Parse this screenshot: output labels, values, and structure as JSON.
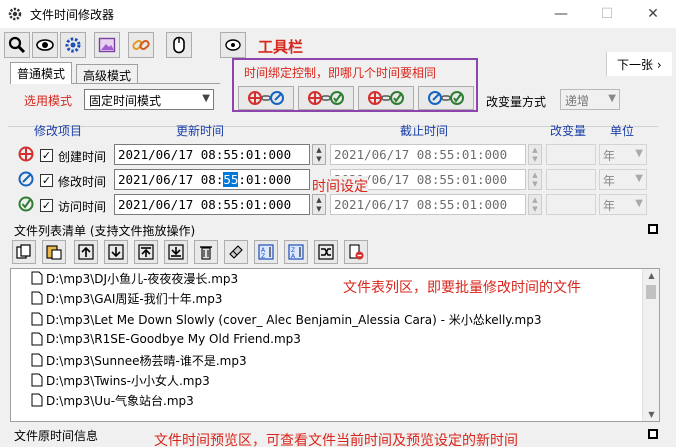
{
  "window": {
    "title": "文件时间修改器",
    "minimize": "—",
    "maximize": "☐",
    "close": "✕"
  },
  "toolbar": {
    "annotation": "工具栏",
    "buttons": [
      "search-icon",
      "eye-icon",
      "settings-gear-icon",
      "image-icon",
      "link-icon",
      "mouse-icon",
      "eye-help-icon"
    ]
  },
  "tabs": [
    {
      "label": "普通模式",
      "active": true
    },
    {
      "label": "高级模式",
      "active": false
    }
  ],
  "link_group": {
    "annotation": "时间绑定控制，即哪几个时间要相同",
    "buttons": [
      "link-create-modify-icon",
      "link-create-access-icon",
      "link-modify-access-icon",
      "link-all-icon"
    ]
  },
  "next": {
    "label": "下一张 ›"
  },
  "mode": {
    "label": "选用模式",
    "value": "固定时间模式"
  },
  "change_mode": {
    "label": "改变量方式",
    "value": "递增"
  },
  "headers": {
    "item": "修改项目",
    "update_time": "更新时间",
    "deadline": "截止时间",
    "change": "改变量",
    "unit": "单位"
  },
  "rows": [
    {
      "label": "创建时间",
      "checked": true,
      "time": "2021/06/17 08:55:01:000",
      "deadline": "2021/06/17 08:55:01:000",
      "unit": "年",
      "icon_color": "#d32f2f"
    },
    {
      "label": "修改时间",
      "checked": true,
      "time_pre": "2021/06/17 08:",
      "time_sel": "55",
      "time_post": ":01:000",
      "deadline": "2021/06/17 08:55:01:000",
      "unit": "年",
      "icon_color": "#1565c0"
    },
    {
      "label": "访问时间",
      "checked": true,
      "time": "2021/06/17 08:55:01:000",
      "deadline": "2021/06/17 08:55:01:000",
      "unit": "年",
      "icon_color": "#2e7d32"
    }
  ],
  "time_set_annotation": "时间设定",
  "checkmark": "✓",
  "filelist_section": {
    "title": "文件列表清单 (支持文件拖放操作)",
    "annotation": "文件表列区，即要批量修改时间的文件",
    "buttons": [
      "copy-icon",
      "paste-icon",
      "move-up-icon",
      "move-down-icon",
      "move-top-icon",
      "move-bottom-icon",
      "delete-icon",
      "clear-icon",
      "sort-asc-icon",
      "sort-desc-icon",
      "shuffle-icon",
      "remove-file-icon"
    ],
    "files": [
      "D:\\mp3\\DJ小鱼儿-夜夜夜漫长.mp3",
      "D:\\mp3\\GAI周延-我们十年.mp3",
      "D:\\mp3\\Let Me Down Slowly (cover_ Alec Benjamin_Alessia Cara) - 米小怂kelly.mp3",
      "D:\\mp3\\R1SE-Goodbye My Old Friend.mp3",
      "D:\\mp3\\Sunnee杨芸晴-谁不是.mp3",
      "D:\\mp3\\Twins-小小女人.mp3",
      "D:\\mp3\\Uu-气象站台.mp3"
    ]
  },
  "preview_section": {
    "title": "文件原时间信息",
    "annotation": "文件时间预览区，可查看文件当前时间及预览设定的新时间"
  },
  "colors": {
    "accent_red": "#d9261c",
    "header_blue": "#1a3fa8",
    "link_frame": "#8e44ad",
    "selection": "#0078d7"
  }
}
